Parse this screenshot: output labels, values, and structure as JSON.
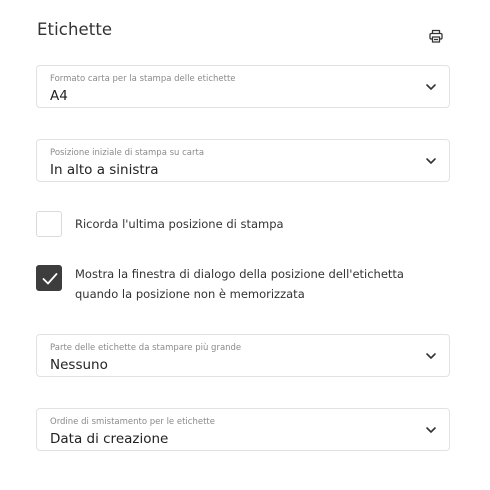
{
  "panel": {
    "title": "Etichette"
  },
  "header": {
    "print_icon": "printer-icon"
  },
  "fields": {
    "paper_format": {
      "label": "Formato carta per la stampa delle etichette",
      "value": "A4"
    },
    "start_position": {
      "label": "Posizione iniziale di stampa su carta",
      "value": "In alto a sinistra"
    },
    "larger_part": {
      "label": "Parte delle etichette da stampare più grande",
      "value": "Nessuno"
    },
    "sort_order": {
      "label": "Ordine di smistamento per le etichette",
      "value": "Data di creazione"
    }
  },
  "checkboxes": {
    "remember_position": {
      "label": "Ricorda l'ultima posizione di stampa",
      "checked": false
    },
    "show_dialog": {
      "label": "Mostra la finestra di dialogo della posizione dell'etichetta quando la posizione non è memorizzata",
      "checked": true
    }
  },
  "colors": {
    "checkbox_checked": "#3d3d3d",
    "border": "#e2e2e2",
    "label_text": "#8a8a8a"
  },
  "icons": {
    "dropdown": "chevron-down-icon",
    "check": "checkmark-icon"
  }
}
